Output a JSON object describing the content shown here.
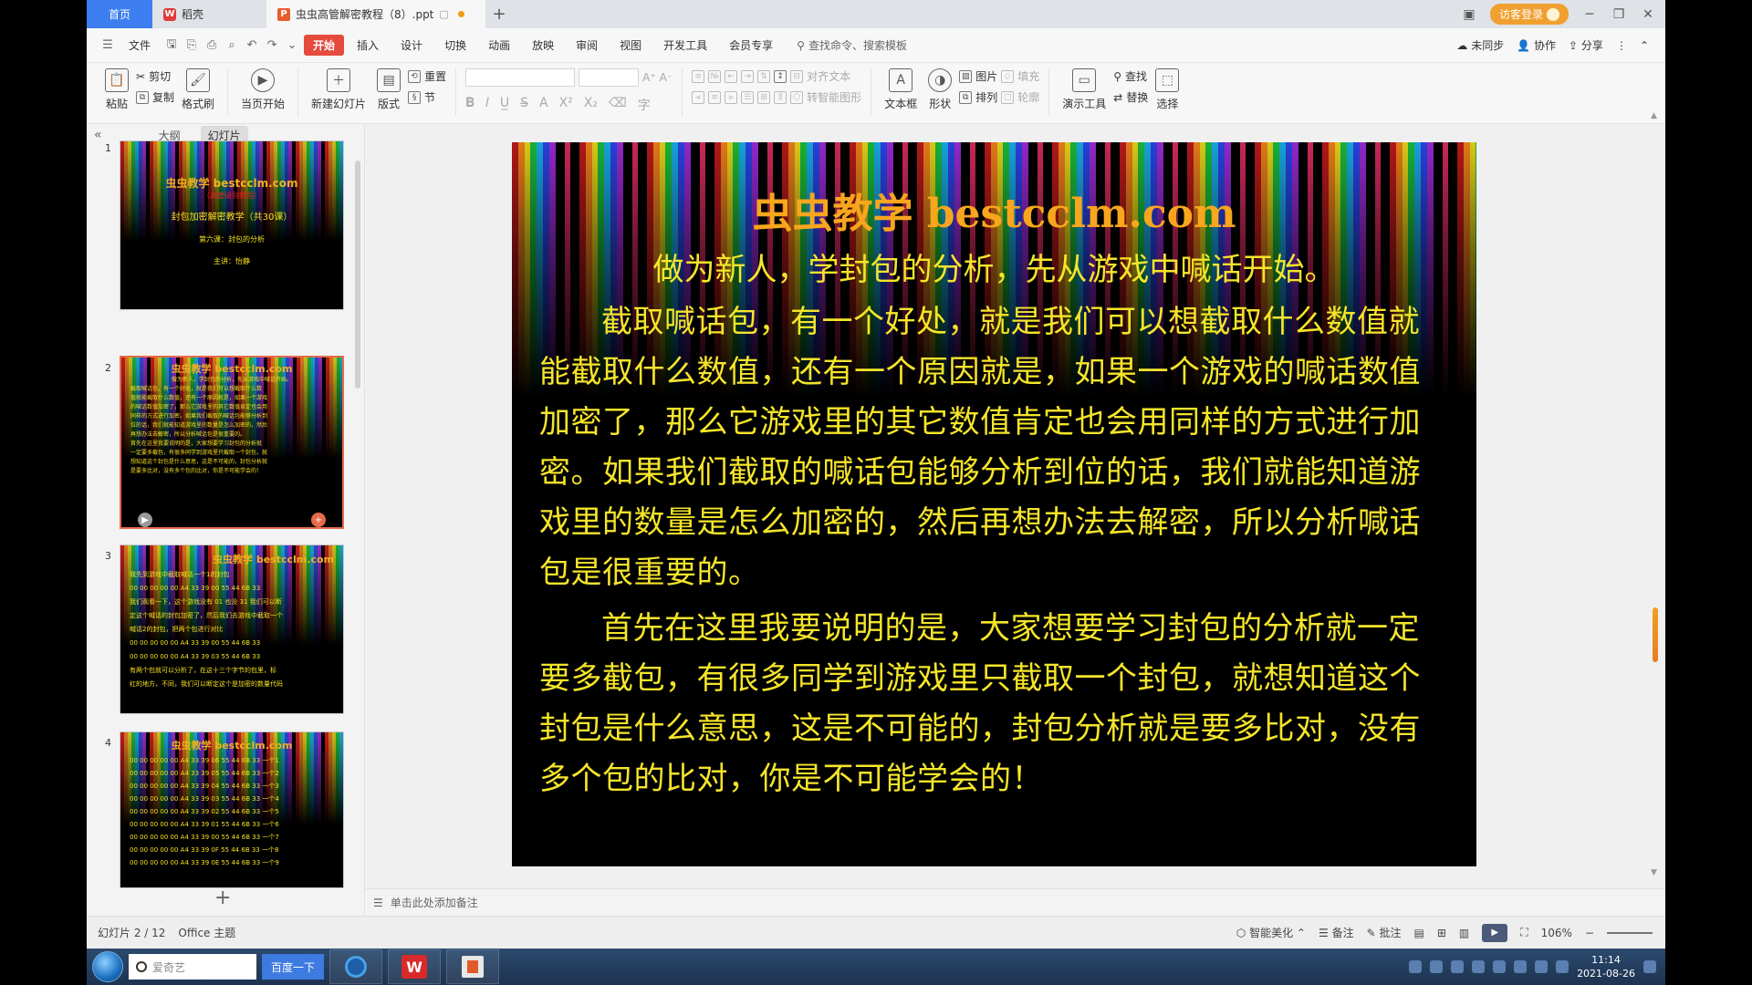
{
  "tabs": {
    "home": "首页",
    "daoke": "稻壳",
    "doc": "虫虫高管解密教程（8）.ppt",
    "add": "+"
  },
  "window": {
    "login": "访客登录"
  },
  "menu": {
    "file": "文件",
    "items": [
      "开始",
      "插入",
      "设计",
      "切换",
      "动画",
      "放映",
      "审阅",
      "视图",
      "开发工具",
      "会员专享"
    ],
    "search": "查找命令、搜索模板",
    "right": [
      "未同步",
      "协作",
      "分享"
    ]
  },
  "ribbon": {
    "paste": "粘贴",
    "cut": "剪切",
    "copy": "复制",
    "format_painter": "格式刷",
    "start_current": "当页开始",
    "new_slide": "新建幻灯片",
    "layout": "版式",
    "reset": "重置",
    "section": "节",
    "align_text": "对齐文本",
    "smart_graphic": "转智能图形",
    "textbox": "文本框",
    "shape": "形状",
    "picture": "图片",
    "arrange": "排列",
    "fill": "填充",
    "outline": "轮廓",
    "present_tools": "演示工具",
    "find": "查找",
    "replace": "替换",
    "select": "选择"
  },
  "leftpanel": {
    "outline_tab": "大纲",
    "slides_tab": "幻灯片",
    "thumbs": [
      {
        "num": "1",
        "title": "虫虫教学 bestcclm.com",
        "sub": "（高管级别教程）",
        "lines": [
          "封包加密解密教学（共30课）",
          "第六课：封包的分析",
          "主讲：怡静"
        ]
      },
      {
        "num": "2",
        "title": "虫虫教学 bestcclm.com",
        "lines": [
          "做为新人，学封包的分析，先从游戏中喊话开始。",
          "截取喊话包，有一个好处，就是我们可以想截取什么数",
          "值就能截取什么数值，还有一个原因就是，如果一个游戏",
          "的喊话数值加密了，那么它游戏里的其它数值肯定也会用",
          "同样的方式进行加密。如果我们截取的喊话包能够分析到",
          "位的话，我们就能知道游戏里的数量是怎么加密的，然后",
          "再想办法去解密，所以分析喊话包是很重要的。",
          "首先在这里我要说明的是，大家想要学习封包的分析就",
          "一定要多截包，有很多同学到游戏里只截取一个封包，就",
          "想知道这个封包是什么意思，这是不可能的，封包分析就",
          "是要多比对，没有多个包的比对，你是不可能学会的！"
        ]
      },
      {
        "num": "3",
        "title": "虫虫教学 bestcclm.com",
        "lines": [
          "我先到游戏中截取喊话一个1的封包",
          "00 00 00 00 00 A4 33 39 00 55 44 6B 33",
          "我们观看一下，这个游戏没有 01 也没 31 我们可以断",
          "定这个喊话的封包加密了，然后我们去游戏中截取一个",
          "喊话2的封包，把两个包进行对比",
          "00 00 00 00 00 A4 33 39 00 55 44 6B 33",
          "00 00 00 00 00 A4 33 39 03 55 44 6B 33",
          "有两个包就可以分析了，在这十三个字节的包里，标",
          "红的地方，不同，我们可以断定这个是加密的数量代码"
        ]
      },
      {
        "num": "4",
        "title": "虫虫教学 bestcclm.com",
        "lines": [
          "00 00 00 00 00 A4 33 39 06  55 44 6B 33  一个1",
          "00 00 00 00 00 A4 33 39 05  55 44 6B 33  一个2",
          "00 00 00 00 00 A4 33 39 04  55 44 6B 33  一个3",
          "00 00 00 00 00 A4 33 39 03  55 44 6B 33  一个4",
          "00 00 00 00 00 A4 33 39 02  55 44 6B 33  一个5",
          "00 00 00 00 00 A4 33 39 01  55 44 6B 33  一个6",
          "00 00 00 00 00 A4 33 39 00  55 44 6B 33  一个7",
          "00 00 00 00 00 A4 33 39 0F  55 44 6B 33  一个8",
          "00 00 00 00 00 A4 33 39 0E  55 44 6B 33  一个9"
        ]
      }
    ]
  },
  "slide": {
    "title": "虫虫教学 bestcclm.com",
    "lead": "做为新人，学封包的分析，先从游戏中喊话开始。",
    "para1": "截取喊话包，有一个好处，就是我们可以想截取什么数值就能截取什么数值，还有一个原因就是，如果一个游戏的喊话数值加密了，那么它游戏里的其它数值肯定也会用同样的方式进行加密。如果我们截取的喊话包能够分析到位的话，我们就能知道游戏里的数量是怎么加密的，然后再想办法去解密，所以分析喊话包是很重要的。",
    "para2": "首先在这里我要说明的是，大家想要学习封包的分析就一定要多截包，有很多同学到游戏里只截取一个封包，就想知道这个封包是什么意思，这是不可能的，封包分析就是要多比对，没有多个包的比对，你是不可能学会的！"
  },
  "notes": {
    "placeholder": "单击此处添加备注"
  },
  "status": {
    "slide_count": "幻灯片 2 / 12",
    "theme": "Office 主题",
    "smart_beautify": "智能美化",
    "notes": "备注",
    "comments": "批注",
    "zoom": "106%"
  },
  "taskbar": {
    "search_placeholder": "爱奇艺",
    "baidu": "百度一下",
    "time": "11:14",
    "date": "2021-08-26"
  },
  "colors": {
    "accent_red": "#e54b3d",
    "slide_title": "#f7a61d",
    "slide_text": "#f5e52a"
  }
}
